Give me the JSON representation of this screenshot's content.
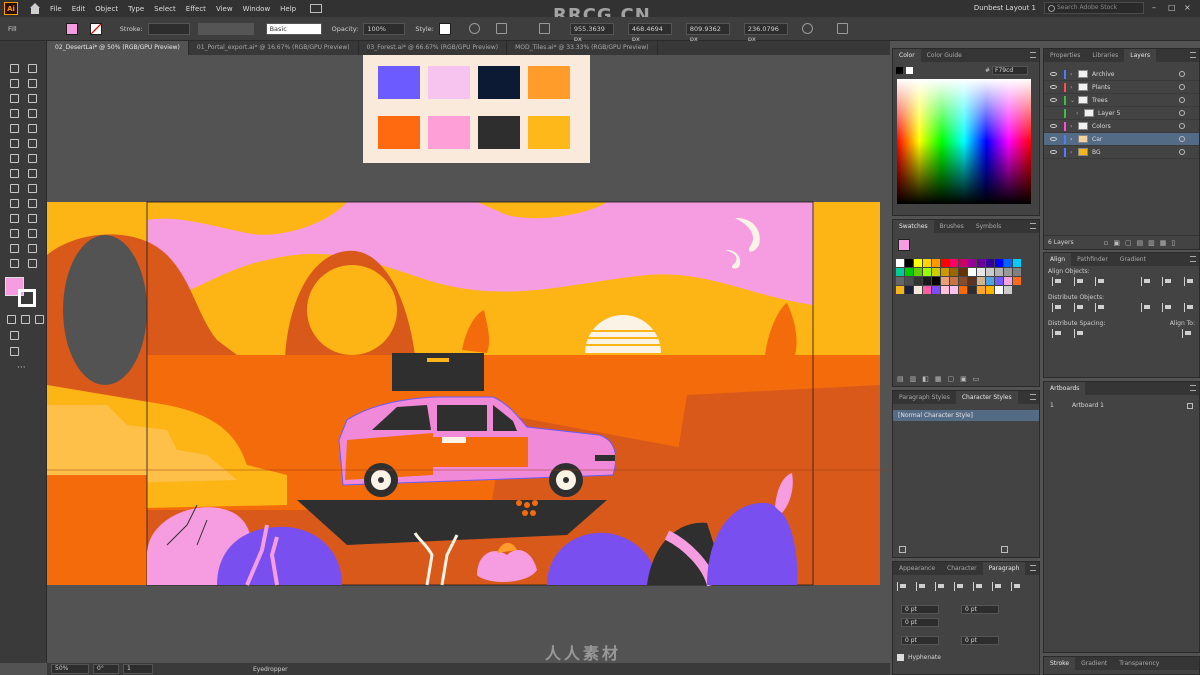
{
  "menubar": {
    "items": [
      "File",
      "Edit",
      "Object",
      "Type",
      "Select",
      "Effect",
      "View",
      "Window",
      "Help"
    ],
    "workspace": "Dunbest Layout 1",
    "search_placeholder": "Search Adobe Stock",
    "watermark": "RRCG.CN"
  },
  "controlbar": {
    "fill_label": "Fill",
    "stroke_label": "Stroke:",
    "stroke_style": "Basic",
    "opacity_label": "Opacity:",
    "opacity_value": "100%",
    "style_label": "Style:",
    "x_value": "955.3639 px",
    "y_value": "468.4694 px",
    "w_value": "809.9362 px",
    "h_value": "236.0796 px"
  },
  "tabs": [
    {
      "label": "02_DesertLai* @ 50% (RGB/GPU Preview)",
      "active": true
    },
    {
      "label": "01_Portal_export.ai* @ 16.67% (RGB/GPU Preview)",
      "active": false
    },
    {
      "label": "03_Forest.ai* @ 66.67% (RGB/GPU Preview)",
      "active": false
    },
    {
      "label": "MOD_Tiles.ai* @ 33.33% (RGB/GPU Preview)",
      "active": false
    }
  ],
  "status": {
    "zoom": "50%",
    "rotation": "0°",
    "page": "1",
    "mode": "Eyedropper",
    "watermark": "人人素材"
  },
  "color_panel": {
    "tabs": [
      "Color",
      "Color Guide"
    ],
    "hex": "F79cd"
  },
  "swatches_panel": {
    "tabs": [
      "Swatches",
      "Brushes",
      "Symbols"
    ],
    "colors": [
      "#ffffff",
      "#000000",
      "#ffff00",
      "#ffd200",
      "#ff9900",
      "#ff0000",
      "#ff0066",
      "#cc0066",
      "#990099",
      "#660099",
      "#330099",
      "#0000ff",
      "#0066ff",
      "#00ccff",
      "#00cc99",
      "#00cc00",
      "#66cc00",
      "#99ff00",
      "#cccc00",
      "#cc9900",
      "#996600",
      "#663300",
      "#ffffff",
      "#e6e6e6",
      "#cccccc",
      "#b3b3b3",
      "#999999",
      "#808080",
      "#666666",
      "#4d4d4d",
      "#333333",
      "#1a1a1a",
      "#000000",
      "#e8a07a",
      "#c67645",
      "#8a4b2a",
      "#5b3320",
      "#d2b48c",
      "#4fa3e0",
      "#6c5bff",
      "#f5a4df",
      "#ff6b1a",
      "#f4b41a",
      "#1c1f3a",
      "#f4e6d8",
      "#ff5fa2",
      "#7a4dff",
      "#ffc1d9",
      "#f7c3ef",
      "#ff6a00",
      "#2e2e2e",
      "#ffa52a",
      "#ffb400",
      "#ffffff",
      "#cccccc"
    ]
  },
  "paragraph_styles": {
    "tabs": [
      "Paragraph Styles",
      "Character Styles"
    ],
    "item": "[Normal Character Style]"
  },
  "bottom_panel": {
    "tabs": [
      "Appearance",
      "Character",
      "Paragraph"
    ],
    "fields": [
      "0 pt",
      "0 pt",
      "0 pt",
      "0 pt",
      "0 pt"
    ],
    "hyphenate": "Hyphenate"
  },
  "layers_panel": {
    "tabs": [
      "Properties",
      "Libraries",
      "Layers"
    ],
    "layers": [
      {
        "name": "Archive",
        "color": "#4f7cff",
        "selected": false
      },
      {
        "name": "Plants",
        "color": "#ff4f4f",
        "selected": false
      },
      {
        "name": "Trees",
        "color": "#3fbf3f",
        "selected": false
      },
      {
        "name": "Layer 5",
        "color": "#3fbf3f",
        "selected": false
      },
      {
        "name": "Colors",
        "color": "#ff4fd8",
        "selected": false
      },
      {
        "name": "Car",
        "color": "#4f7cff",
        "selected": true
      },
      {
        "name": "BG",
        "color": "#4f7cff",
        "selected": false
      }
    ],
    "count": "6 Layers"
  },
  "align_panel": {
    "tabs": [
      "Align",
      "Pathfinder",
      "Gradient"
    ],
    "align_objects": "Align Objects:",
    "distribute_objects": "Distribute Objects:",
    "distribute_spacing": "Distribute Spacing:",
    "align_to": "Align To:"
  },
  "artboards_panel": {
    "tabs": [
      "Artboards"
    ],
    "number": "1",
    "name": "Artboard 1"
  },
  "stroke_panel": {
    "tabs": [
      "Stroke",
      "Gradient",
      "Transparency"
    ]
  },
  "palette": {
    "row1": [
      "#6c5bff",
      "#f7c3ef",
      "#0c1a33",
      "#ff9c2a"
    ],
    "row2": [
      "#ff6a10",
      "#ff9fd8",
      "#2e2e2e",
      "#ffb81a"
    ]
  },
  "colors": {
    "sky_pink": "#f59de0",
    "desert_yellow": "#fdb515",
    "desert_orange": "#f46b0c",
    "rock_rust": "#d9591b",
    "dark": "#2f2f2f",
    "purple": "#7a4ff0",
    "car_pink": "#f08ad8"
  }
}
